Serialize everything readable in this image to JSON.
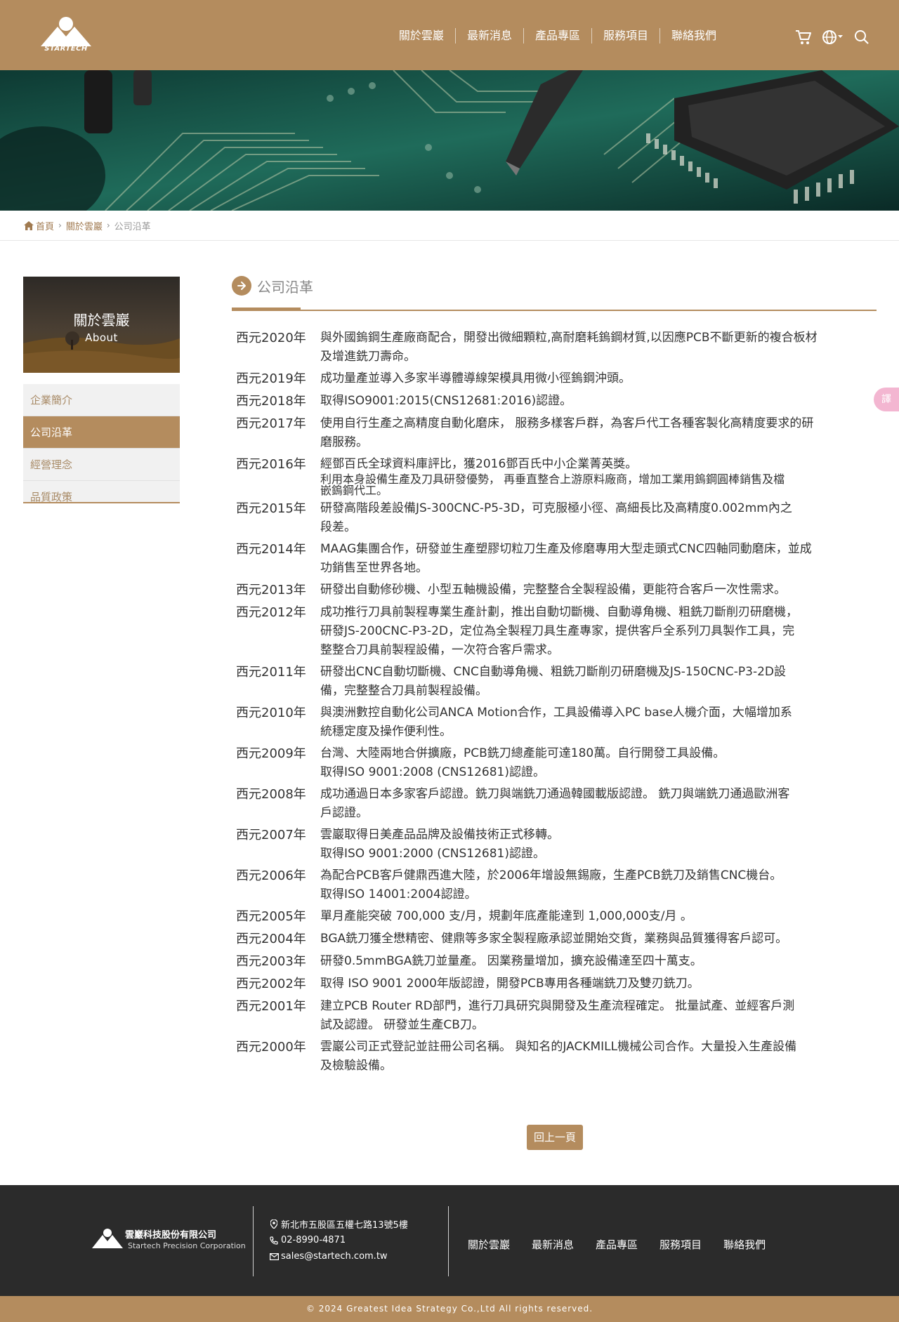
{
  "header": {
    "logo_text": "STARTECH",
    "nav": [
      "關於雲巖",
      "最新消息",
      "產品專區",
      "服務項目",
      "聯絡我們"
    ]
  },
  "breadcrumb": [
    "首頁",
    "關於雲巖",
    "公司沿革"
  ],
  "sidebar": {
    "title": "關於雲巖",
    "subtitle": "About",
    "items": [
      "企業簡介",
      "公司沿革",
      "經營理念",
      "品質政策"
    ],
    "active_index": 1
  },
  "main": {
    "title": "公司沿革",
    "timeline": [
      {
        "year": "西元2020年",
        "lines": [
          "與外國鎢鋼生產廠商配合，開發出微細顆粒,高耐磨耗鎢鋼材質,以因應PCB不斷更新的複合板材",
          "及增進銑刀壽命。"
        ]
      },
      {
        "year": "西元2019年",
        "lines": [
          "成功量產並導入多家半導體導線架模具用微小徑鎢鋼沖頭。"
        ]
      },
      {
        "year": "西元2018年",
        "lines": [
          "取得ISO9001:2015(CNS12681:2016)認證。"
        ]
      },
      {
        "year": "西元2017年",
        "lines": [
          "使用自行生產之高精度自動化磨床， 服務多樣客戶群，為客戶代工各種客製化高精度要求的研",
          "磨服務。"
        ]
      },
      {
        "year": "西元2016年",
        "lines": [
          "經鄧百氏全球資料庫評比，獲2016鄧百氏中小企業菁英獎。",
          "利用本身設備生產及刀具研發優勢， 再垂直整合上游原料廠商，增加工業用鎢鋼圓棒銷售及檔",
          "嵌鎢鋼代工。"
        ]
      },
      {
        "year": "西元2015年",
        "lines": [
          "研發高階段差設備JS-300CNC-P5-3D，可克服極小徑、高細長比及高精度0.002mm內之",
          "段差。"
        ]
      },
      {
        "year": "西元2014年",
        "lines": [
          "MAAG集團合作，研發並生產塑膠切粒刀生產及修磨專用大型走頭式CNC四軸同動磨床，並成",
          "功銷售至世界各地。"
        ]
      },
      {
        "year": "西元2013年",
        "lines": [
          "研發出自動修砂機、小型五軸機設備，完整整合全製程設備，更能符合客戶一次性需求。"
        ]
      },
      {
        "year": "西元2012年",
        "lines": [
          "成功推行刀具前製程專業生產計劃，推出自動切斷機、自動導角機、粗銑刀斷削刃研磨機，",
          "研發JS-200CNC-P3-2D，定位為全製程刀具生產專家，提供客戶全系列刀具製作工具，完",
          "整整合刀具前製程設備，一次符合客戶需求。"
        ]
      },
      {
        "year": "西元2011年",
        "lines": [
          "研發出CNC自動切斷機、CNC自動導角機、粗銑刀斷削刃研磨機及JS-150CNC-P3-2D設",
          "備，完整整合刀具前製程設備。"
        ]
      },
      {
        "year": "西元2010年",
        "lines": [
          "與澳洲數控自動化公司ANCA Motion合作，工具設備導入PC base人機介面，大幅增加系",
          "統穩定度及操作便利性。"
        ]
      },
      {
        "year": "西元2009年",
        "lines": [
          "台灣、大陸兩地合併擴廠，PCB銑刀總產能可達180萬。自行開發工具設備。",
          "取得ISO 9001:2008 (CNS12681)認證。"
        ]
      },
      {
        "year": "西元2008年",
        "lines": [
          "成功通過日本多家客戶認證。銑刀與端銑刀通過韓國載版認證。 銑刀與端銑刀通過歐洲客",
          "戶認證。"
        ]
      },
      {
        "year": "西元2007年",
        "lines": [
          "雲巖取得日美產品品牌及設備技術正式移轉。",
          "取得ISO 9001:2000 (CNS12681)認證。"
        ]
      },
      {
        "year": "西元2006年",
        "lines": [
          "為配合PCB客戶健鼎西進大陸，於2006年增設無錫廠，生產PCB銑刀及銷售CNC機台。",
          "取得ISO 14001:2004認證。"
        ]
      },
      {
        "year": "西元2005年",
        "lines": [
          "單月產能突破 700,000 支/月，規劃年底產能達到 1,000,000支/月 。"
        ]
      },
      {
        "year": "西元2004年",
        "lines": [
          "BGA銑刀獲全懋精密、健鼎等多家全製程廠承認並開始交貨，業務與品質獲得客戶認可。"
        ]
      },
      {
        "year": "西元2003年",
        "lines": [
          "研發0.5mmBGA銑刀並量產。 因業務量增加，擴充設備達至四十萬支。"
        ]
      },
      {
        "year": "西元2002年",
        "lines": [
          "取得 ISO 9001 2000年版認證，開發PCB專用各種端銑刀及雙刃銑刀。"
        ]
      },
      {
        "year": "西元2001年",
        "lines": [
          "建立PCB Router RD部門，進行刀具研究與開發及生產流程確定。 批量試產、並經客戶測",
          "試及認證。 研發並生產CB刀。"
        ]
      },
      {
        "year": "西元2000年",
        "lines": [
          "雲巖公司正式登記並註冊公司名稱。 與知名的JACKMILL機械公司合作。大量投入生產設備",
          "及檢驗設備。"
        ]
      }
    ],
    "back_label": "回上一頁"
  },
  "float_translate": "譯",
  "footer": {
    "company": "雲巖科技股份有限公司",
    "company_en": "Startech Precision Corporation",
    "address": "新北市五股區五權七路13號5樓",
    "phone": "02-8990-4871",
    "email": "sales@startech.com.tw",
    "nav": [
      "關於雲巖",
      "最新消息",
      "產品專區",
      "服務項目",
      "聯絡我們"
    ],
    "copyright": "© 2024 Greatest Idea Strategy Co.,Ltd All rights reserved."
  },
  "colors": {
    "brand": "#b48c5e",
    "footer_bg": "#2b2b2b",
    "menu_bg": "#f1f1f1"
  },
  "icons": [
    "cart-icon",
    "globe-icon",
    "search-icon",
    "home-icon",
    "location-icon",
    "phone-icon",
    "mail-icon",
    "arrow-right-icon"
  ]
}
